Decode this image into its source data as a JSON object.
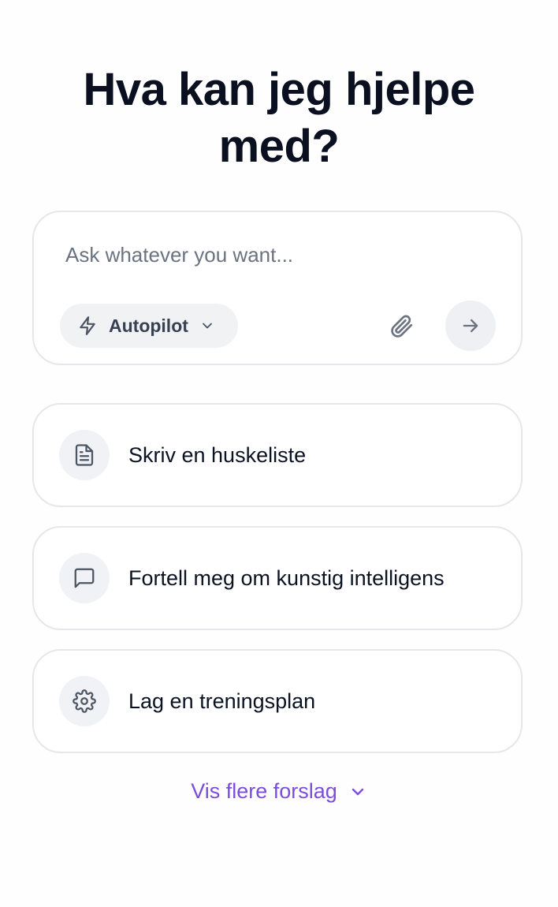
{
  "heading": {
    "line1": "Hva kan jeg hjelpe",
    "line2": "med?"
  },
  "composer": {
    "placeholder": "Ask whatever you want...",
    "mode_label": "Autopilot",
    "mode_icon": "lightning-bolt-icon",
    "attach_icon": "paperclip-icon",
    "send_icon": "arrow-right-icon"
  },
  "suggestions": [
    {
      "label": "Skriv en huskeliste",
      "icon": "document-icon"
    },
    {
      "label": "Fortell meg om kunstig intelligens",
      "icon": "chat-bubble-icon"
    },
    {
      "label": "Lag en treningsplan",
      "icon": "gear-icon"
    }
  ],
  "more": {
    "label": "Vis flere forslag",
    "icon": "chevron-down-icon"
  },
  "colors": {
    "accent": "#7c4ddb",
    "text": "#0b1222",
    "muted_text": "#6b7280",
    "border": "#e6e7ea",
    "chip_bg": "#f1f2f4"
  }
}
